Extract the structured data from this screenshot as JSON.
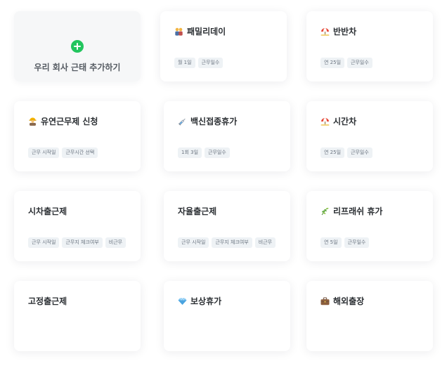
{
  "add_card": {
    "label": "우리 회사 근태 추가하기",
    "icon": "plus-circle-icon",
    "color": "#22c55e"
  },
  "cards": [
    {
      "title": "패밀리데이",
      "icon": "family-icon",
      "tags": [
        "월 1일",
        "근무일수"
      ]
    },
    {
      "title": "반반차",
      "icon": "beach-umbrella-icon",
      "tags": [
        "연 25일",
        "근무일수"
      ]
    },
    {
      "title": "유연근무제 신청",
      "icon": "worker-icon",
      "tags": [
        "근무 시작일",
        "근무시간 선택"
      ]
    },
    {
      "title": "백신접종휴가",
      "icon": "syringe-icon",
      "tags": [
        "1회 3일",
        "근무일수"
      ]
    },
    {
      "title": "시간차",
      "icon": "beach-umbrella-icon",
      "tags": [
        "연 25일",
        "근무일수"
      ]
    },
    {
      "title": "시차출근제",
      "icon": "",
      "tags": [
        "근무 시작일",
        "근무지 체크여부",
        "비근무"
      ]
    },
    {
      "title": "자율출근제",
      "icon": "",
      "tags": [
        "근무 시작일",
        "근무지 체크여부",
        "비근무"
      ]
    },
    {
      "title": "리프래쉬 휴가",
      "icon": "herb-icon",
      "tags": [
        "연 5일",
        "근무일수"
      ]
    },
    {
      "title": "고정출근제",
      "icon": "",
      "tags": []
    },
    {
      "title": "보상휴가",
      "icon": "gem-icon",
      "tags": []
    },
    {
      "title": "해외출장",
      "icon": "briefcase-icon",
      "tags": []
    }
  ]
}
